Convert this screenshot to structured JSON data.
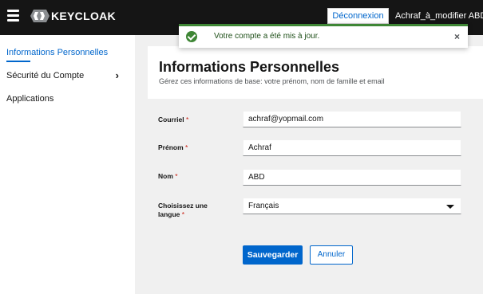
{
  "header": {
    "brand": "KEYCLOAK",
    "logout_label": "Déconnexion",
    "user_name": "Achraf_à_modifier ABD"
  },
  "sidebar": {
    "items": [
      {
        "label": "Informations Personnelles",
        "active": true
      },
      {
        "label": "Sécurité du Compte",
        "has_children": true
      },
      {
        "label": "Applications"
      }
    ]
  },
  "page": {
    "title": "Informations Personnelles",
    "subtitle": "Gérez ces informations de base: votre prénom, nom de famille et email"
  },
  "form": {
    "email": {
      "label": "Courriel",
      "value": "achraf@yopmail.com"
    },
    "first_name": {
      "label": "Prénom",
      "value": "Achraf"
    },
    "last_name": {
      "label": "Nom",
      "value": "ABD"
    },
    "language": {
      "label": "Choisissez une langue",
      "value": "Français"
    },
    "required_mark": "*",
    "save_label": "Sauvegarder",
    "cancel_label": "Annuler"
  },
  "toast": {
    "message": "Votre compte a été mis à jour.",
    "close_symbol": "×"
  },
  "colors": {
    "header_bg": "#151515",
    "accent": "#0066cc",
    "success": "#3e8635",
    "required": "#c9190b"
  },
  "icons": [
    "menu-icon",
    "keycloak-logo-icon",
    "chevron-right-icon",
    "caret-down-icon",
    "check-circle-icon",
    "close-icon"
  ]
}
